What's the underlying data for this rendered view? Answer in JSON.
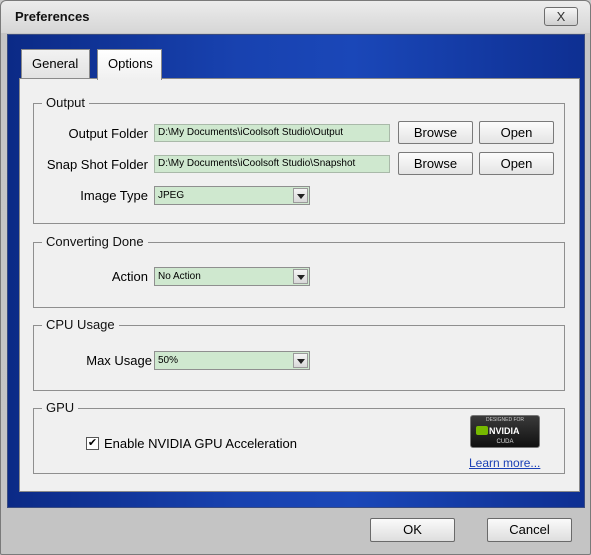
{
  "window": {
    "title": "Preferences",
    "close_label": "X"
  },
  "tabs": [
    {
      "label": "General"
    },
    {
      "label": "Options"
    }
  ],
  "output": {
    "title": "Output",
    "output_folder": {
      "label": "Output Folder",
      "value": "D:\\My Documents\\iCoolsoft Studio\\Output",
      "browse": "Browse",
      "open": "Open"
    },
    "snapshot_folder": {
      "label": "Snap Shot Folder",
      "value": "D:\\My Documents\\iCoolsoft Studio\\Snapshot",
      "browse": "Browse",
      "open": "Open"
    },
    "image_type": {
      "label": "Image Type",
      "value": "JPEG"
    }
  },
  "converting_done": {
    "title": "Converting Done",
    "action_label": "Action",
    "action_value": "No Action"
  },
  "cpu_usage": {
    "title": "CPU Usage",
    "max_usage_label": "Max Usage",
    "max_usage_value": "50%"
  },
  "gpu": {
    "title": "GPU",
    "checkbox_label": "Enable NVIDIA GPU Acceleration",
    "checked": true,
    "badge": {
      "top": "DESIGNED FOR",
      "brand": "NVIDIA",
      "sub": "CUDA"
    },
    "learn_more": "Learn more..."
  },
  "footer": {
    "ok": "OK",
    "cancel": "Cancel"
  },
  "colors": {
    "accent_blue": "#1a47b8",
    "field_green": "#cfe8cf",
    "nvidia_green": "#76b900"
  }
}
